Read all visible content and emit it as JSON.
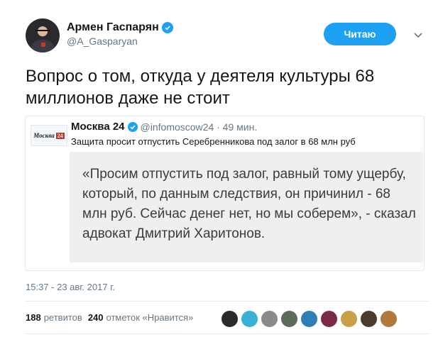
{
  "author": {
    "display_name": "Армен Гаспарян",
    "handle": "@A_Gasparyan"
  },
  "follow_button_label": "Читаю",
  "tweet_text_line1": "Вопрос о том, откуда у деятеля культуры 68",
  "tweet_text_line2": "миллионов даже не стоит",
  "quote": {
    "avatar_label": "Москва",
    "avatar_num": "24",
    "name": "Москва 24",
    "handle_time": "@infomoscow24 · 49 мин.",
    "text": "Защита просит отпустить Серебренникова под залог в 68 млн руб",
    "image_text": "«Просим отпустить под залог, равный тому ущербу, который, по данным следствия, он причинил - 68 млн руб. Сейчас денег нет, но мы соберем», - сказал адвокат Дмитрий Харитонов."
  },
  "timestamp": "15:37 - 23 авг. 2017 г.",
  "stats": {
    "retweets_count": "188",
    "retweets_label": "ретвитов",
    "likes_count": "240",
    "likes_label": "отметок «Нравится»"
  },
  "colors": {
    "accent": "#1da1f2",
    "muted": "#657786",
    "text": "#14171a",
    "brand_red": "#c0392b"
  },
  "liker_avatar_colors": [
    "#2b2b2b",
    "#3ab0d8",
    "#8a8a8a",
    "#5c6b5a",
    "#2f7fb5",
    "#7a2b4a",
    "#c9a04a",
    "#4a3b2e",
    "#b07a3a"
  ],
  "icons": {
    "verified": "verified-badge-icon",
    "menu": "chevron-down-icon"
  }
}
